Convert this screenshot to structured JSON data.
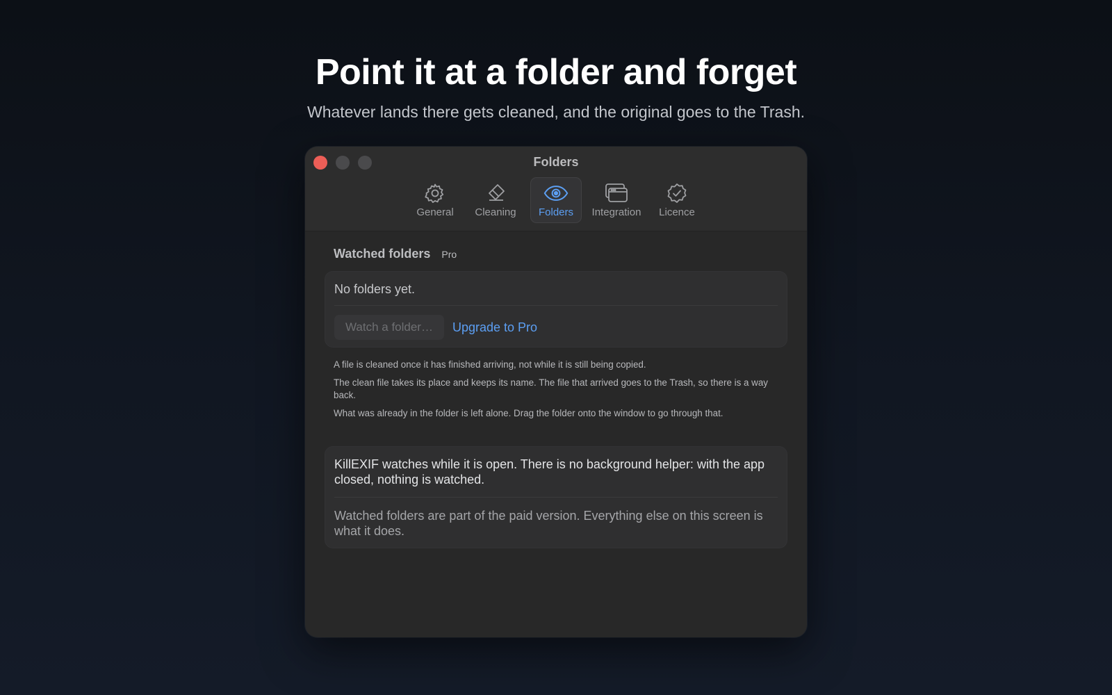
{
  "hero": {
    "title": "Point it at a folder and forget",
    "subtitle": "Whatever lands there gets cleaned, and the original goes to the Trash."
  },
  "window": {
    "title": "Folders",
    "tabs": [
      {
        "label": "General",
        "icon": "gear-icon",
        "active": false
      },
      {
        "label": "Cleaning",
        "icon": "eraser-icon",
        "active": false
      },
      {
        "label": "Folders",
        "icon": "eye-icon",
        "active": true
      },
      {
        "label": "Integration",
        "icon": "windows-icon",
        "active": false
      },
      {
        "label": "Licence",
        "icon": "checkmark-seal-icon",
        "active": false
      }
    ],
    "accent_color": "#5c9ff3"
  },
  "watched": {
    "title": "Watched folders",
    "badge": "Pro",
    "empty_text": "No folders yet.",
    "watch_placeholder": "Watch a folder…",
    "upgrade_label": "Upgrade to Pro",
    "notes": [
      "A file is cleaned once it has finished arriving, not while it is still being copied.",
      "The clean file takes its place and keeps its name. The file that arrived goes to the Trash, so there is a way back.",
      "What was already in the folder is left alone. Drag the folder onto the window to go through that."
    ]
  },
  "info": {
    "primary": "KillEXIF watches while it is open. There is no background helper: with the app closed, nothing is watched.",
    "secondary": "Watched folders are part of the paid version. Everything else on this screen is what it does."
  }
}
